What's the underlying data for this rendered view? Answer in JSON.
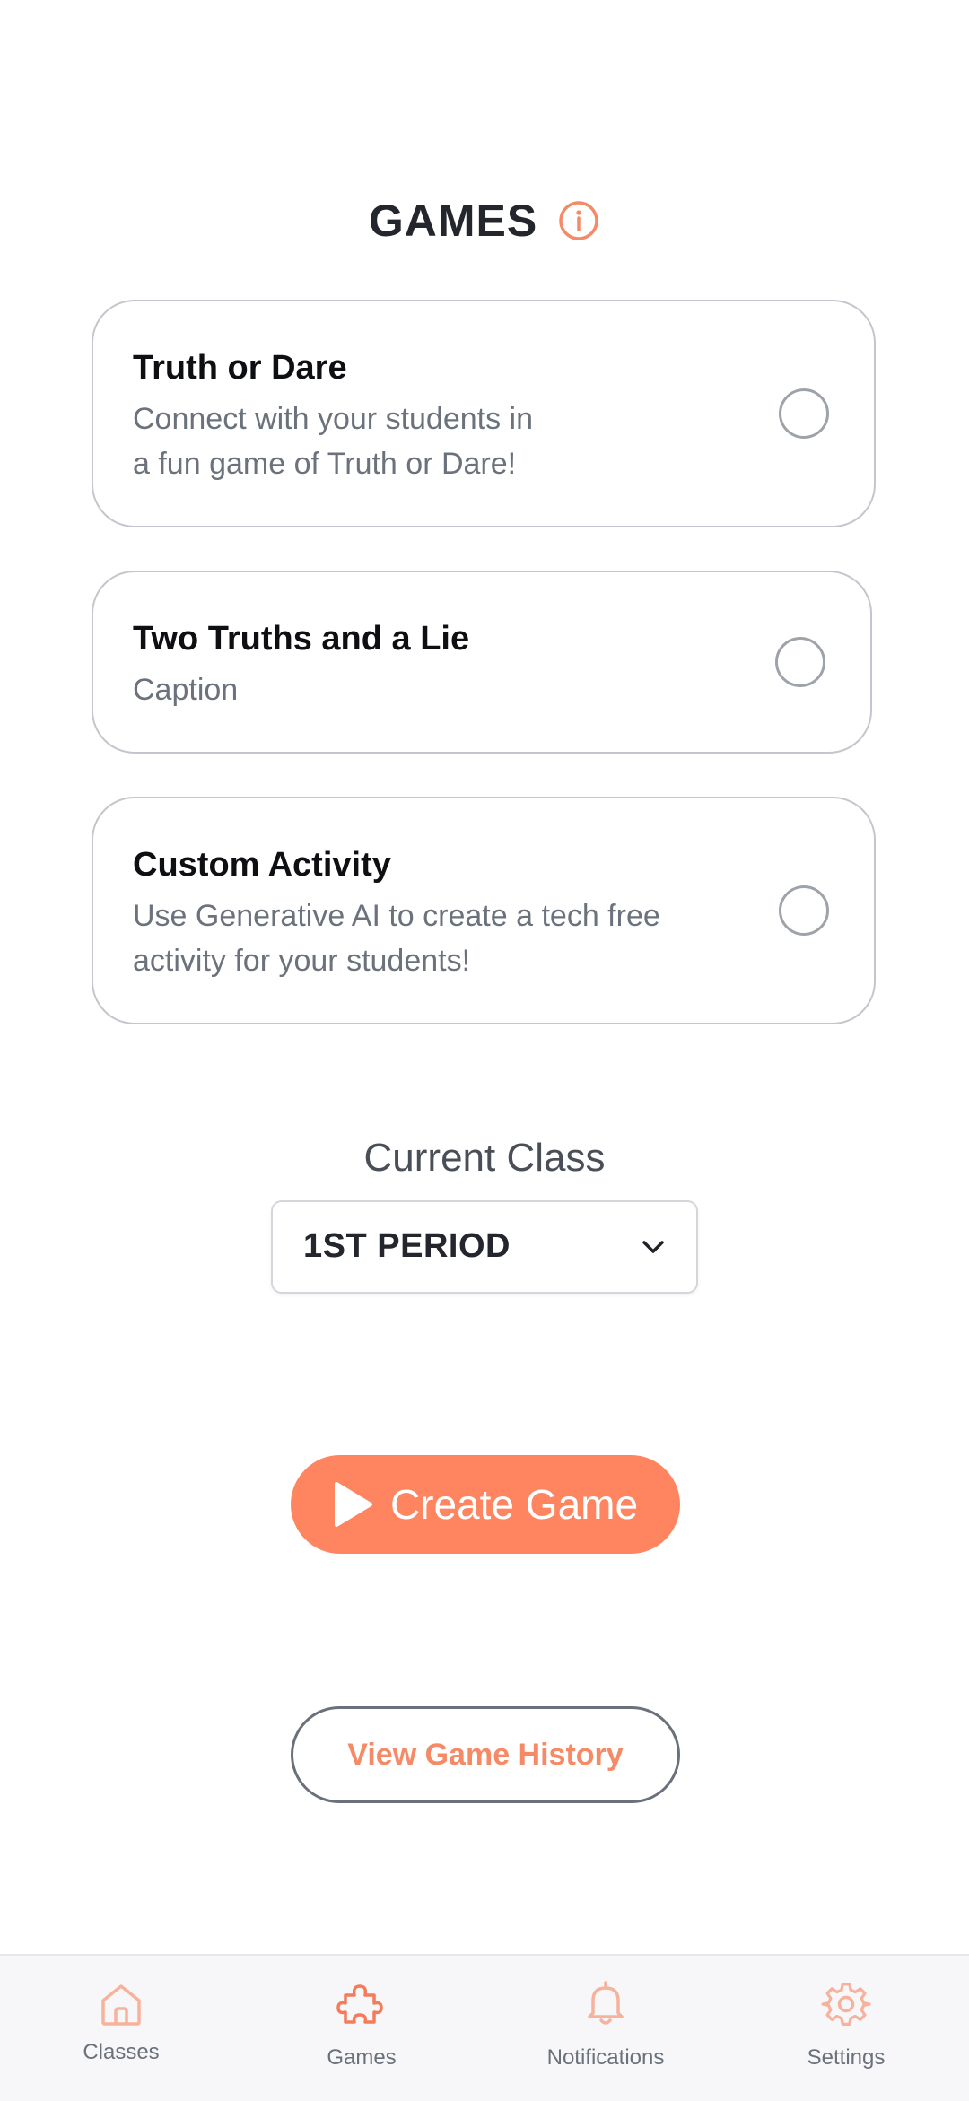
{
  "header": {
    "title": "GAMES",
    "info_icon": "info-circle-icon"
  },
  "games": [
    {
      "title": "Truth or Dare",
      "caption_lines": [
        "Connect with your students in",
        "a fun game of Truth or Dare!"
      ],
      "selected": false
    },
    {
      "title": "Two Truths and a Lie",
      "caption_lines": [
        "Caption"
      ],
      "selected": false
    },
    {
      "title": "Custom Activity",
      "caption_lines": [
        "Use Generative AI to create a tech free",
        "activity for your students!"
      ],
      "selected": false
    }
  ],
  "class_selector": {
    "label": "Current Class",
    "value": "1ST PERIOD"
  },
  "create_button": {
    "label": "Create Game",
    "icon": "play-icon"
  },
  "history_button": {
    "label": "View Game History"
  },
  "tabbar": {
    "items": [
      {
        "label": "Classes",
        "icon": "home-icon"
      },
      {
        "label": "Games",
        "icon": "puzzle-icon",
        "active": true
      },
      {
        "label": "Notifications",
        "icon": "bell-icon"
      },
      {
        "label": "Settings",
        "icon": "gear-icon"
      }
    ]
  },
  "colors": {
    "accent": "#ff8560",
    "accent_text": "#f58a66",
    "border": "#c3c6cc",
    "muted_text": "#6b727c"
  }
}
